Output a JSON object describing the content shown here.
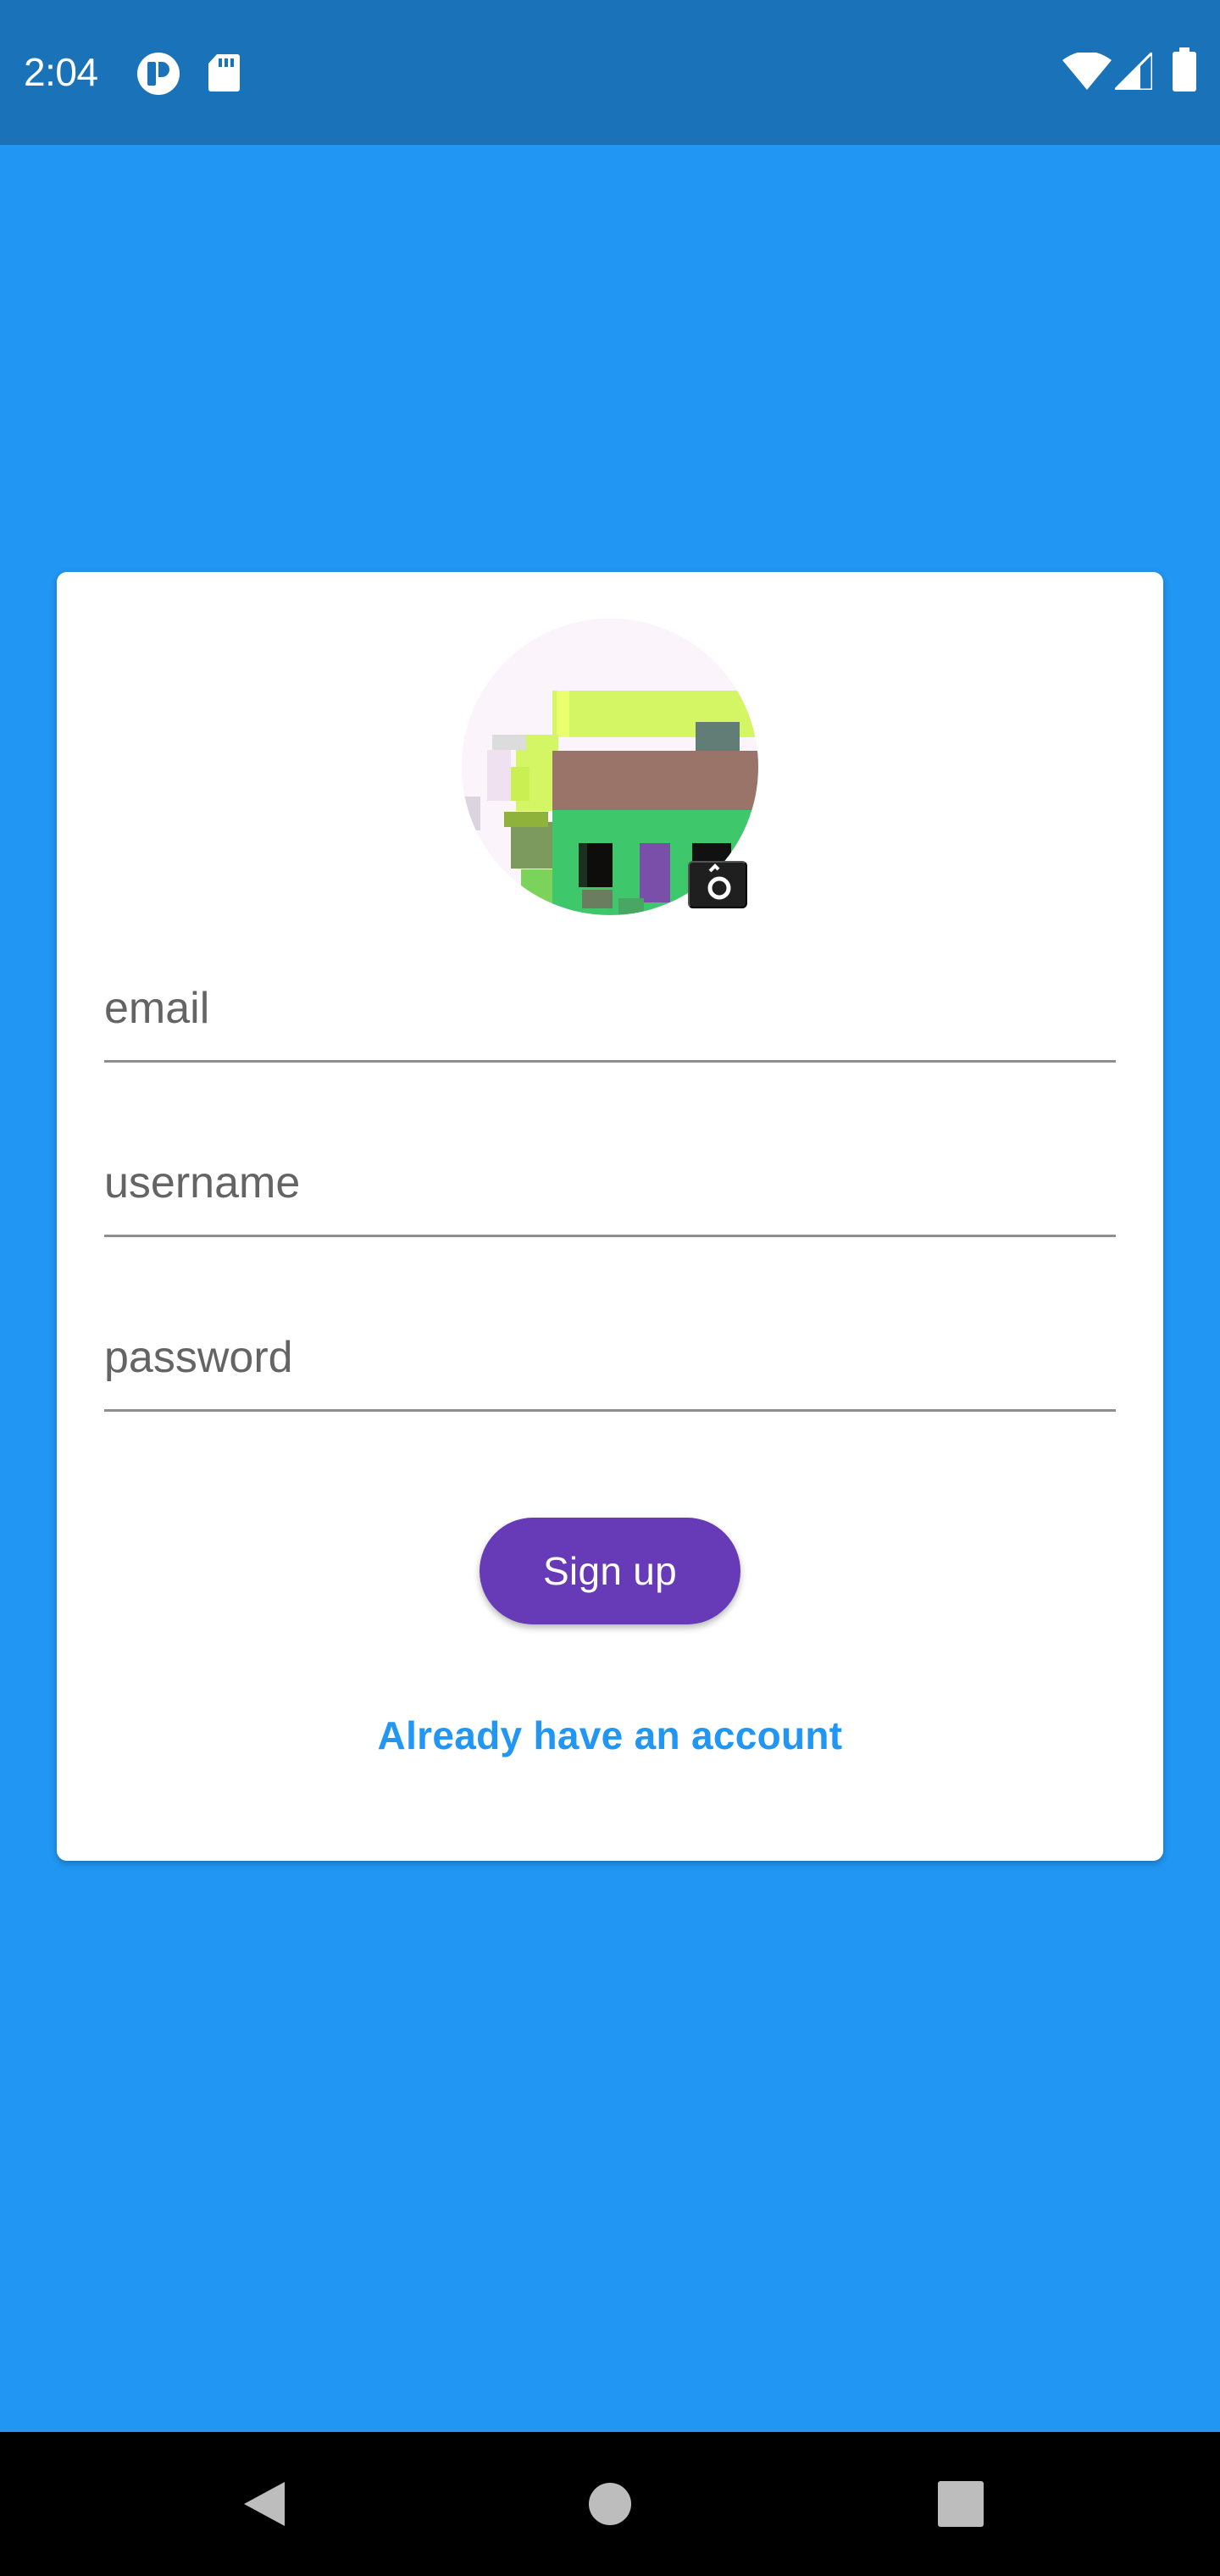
{
  "status_bar": {
    "time": "2:04",
    "icons": [
      "app-notification-icon",
      "sd-card-icon",
      "wifi-icon",
      "cell-signal-icon",
      "battery-icon"
    ]
  },
  "signup_form": {
    "avatar_icon": "camera-icon",
    "fields": {
      "email": {
        "placeholder": "email",
        "value": ""
      },
      "username": {
        "placeholder": "username",
        "value": ""
      },
      "password": {
        "placeholder": "password",
        "value": ""
      }
    },
    "submit_label": "Sign up",
    "login_link_label": "Already have an account"
  },
  "navigation": {
    "buttons": [
      "back-icon",
      "home-icon",
      "recents-icon"
    ]
  },
  "colors": {
    "status_bar": "#1a73b9",
    "background": "#2196f3",
    "card": "#ffffff",
    "primary_button": "#673ab7",
    "link": "#2196f3"
  }
}
